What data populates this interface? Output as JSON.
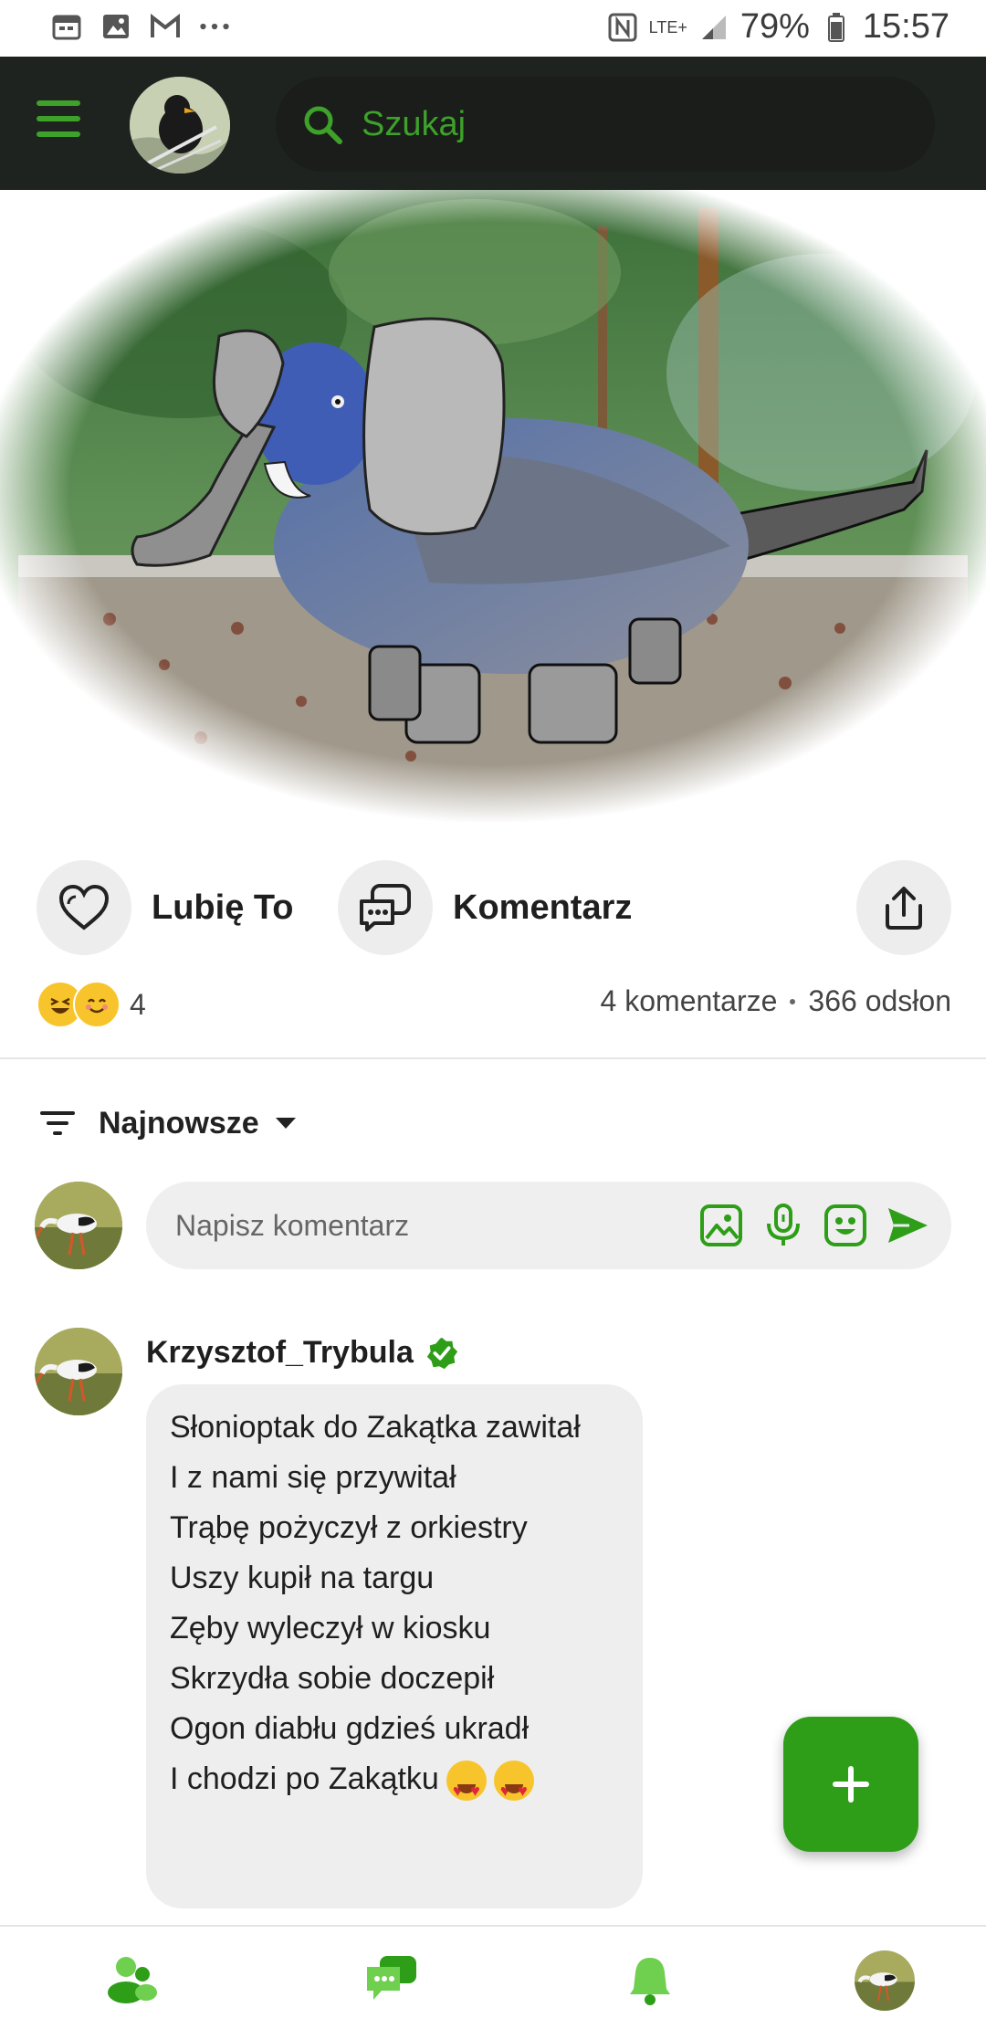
{
  "status_bar": {
    "battery": "79%",
    "time": "15:57",
    "network": "LTE+",
    "icons": [
      "calendar-icon",
      "gallery-icon",
      "gmail-icon",
      "more-dots-icon",
      "nfc-icon",
      "signal-icon",
      "battery-icon"
    ]
  },
  "app_bar": {
    "search_placeholder": "Szukaj",
    "accent": "#3da12a",
    "background": "#1f231f"
  },
  "post": {
    "like_label": "Lubię To",
    "comment_label": "Komentarz",
    "reactions_count": "4",
    "comments_count": "4 komentarze",
    "views": "366 odsłon"
  },
  "comments_section": {
    "sort_label": "Najnowsze",
    "input_placeholder": "Napisz komentarz",
    "comment": {
      "author": "Krzysztof_Trybula",
      "lines": [
        "Słonioptak do Zakątka zawitał",
        "I z nami się przywitał",
        "Trąbę pożyczył z orkiestry",
        "Uszy kupił na targu",
        "Zęby wyleczył w kiosku",
        "Skrzydła sobie doczepił",
        "Ogon diabłu gdzieś ukradł",
        "I chodzi po Zakątku"
      ]
    }
  },
  "bottom_nav": {
    "items": [
      "community-icon",
      "chat-icon",
      "notifications-icon",
      "profile-avatar"
    ]
  }
}
